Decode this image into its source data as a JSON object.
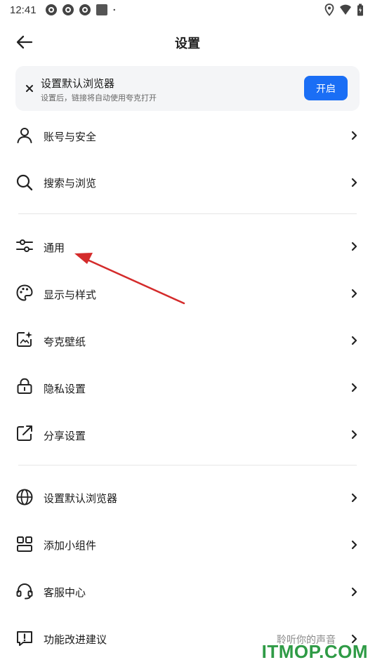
{
  "status_bar": {
    "time": "12:41",
    "icons": [
      "notification-icon",
      "notification-icon",
      "notification-icon",
      "app-icon",
      "dot-icon",
      "location-icon",
      "wifi-icon",
      "battery-icon"
    ]
  },
  "header": {
    "title": "设置",
    "back_icon": "arrow-left-icon"
  },
  "banner": {
    "title": "设置默认浏览器",
    "subtitle": "设置后，链接将自动使用夸克打开",
    "button_label": "开启",
    "close_icon": "close-icon"
  },
  "sections": [
    {
      "items": [
        {
          "label": "账号与安全",
          "icon": "user-icon"
        },
        {
          "label": "搜索与浏览",
          "icon": "search-icon"
        }
      ]
    },
    {
      "items": [
        {
          "label": "通用",
          "icon": "sliders-icon"
        },
        {
          "label": "显示与样式",
          "icon": "palette-icon"
        },
        {
          "label": "夸克壁纸",
          "icon": "wallpaper-icon"
        },
        {
          "label": "隐私设置",
          "icon": "lock-icon"
        },
        {
          "label": "分享设置",
          "icon": "share-icon"
        }
      ]
    },
    {
      "items": [
        {
          "label": "设置默认浏览器",
          "icon": "globe-icon"
        },
        {
          "label": "添加小组件",
          "icon": "widget-icon"
        },
        {
          "label": "客服中心",
          "icon": "headset-icon"
        },
        {
          "label": "功能改进建议",
          "icon": "feedback-icon",
          "hint": "聆听你的声音"
        }
      ]
    }
  ],
  "colors": {
    "accent": "#1a6ef5",
    "annotation_arrow": "#d42b2b",
    "watermark": "#2f9b46"
  },
  "watermark": "ITMOP.COM"
}
